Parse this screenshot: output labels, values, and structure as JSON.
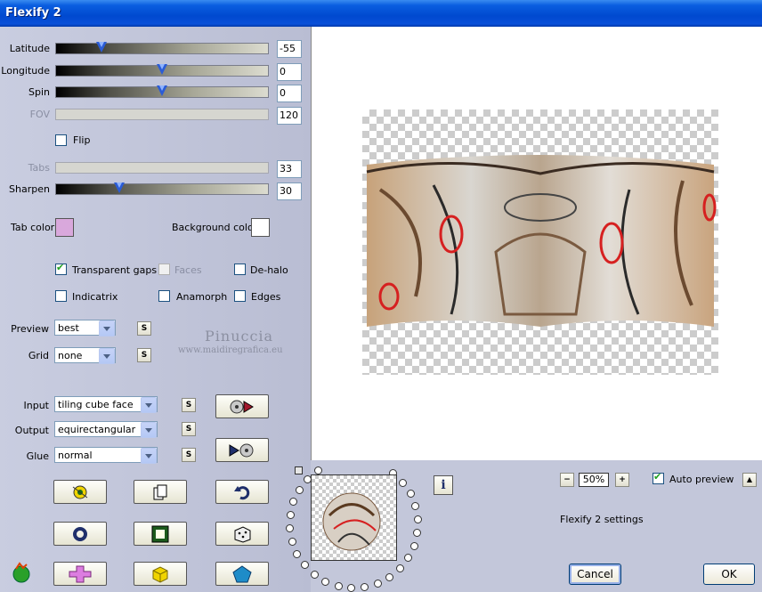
{
  "window": {
    "title": "Flexify 2"
  },
  "sliders": [
    {
      "label": "Latitude",
      "value": "-55",
      "fraction": 0.215,
      "enabled": true
    },
    {
      "label": "Longitude",
      "value": "0",
      "fraction": 0.5,
      "enabled": true
    },
    {
      "label": "Spin",
      "value": "0",
      "fraction": 0.5,
      "enabled": true
    },
    {
      "label": "FOV",
      "value": "120",
      "fraction": 0.0,
      "enabled": false
    },
    {
      "label": "Tabs",
      "value": "33",
      "fraction": 0.0,
      "enabled": false
    },
    {
      "label": "Sharpen",
      "value": "30",
      "fraction": 0.3,
      "enabled": true
    }
  ],
  "flip": {
    "label": "Flip",
    "checked": false
  },
  "colors": {
    "tab_label": "Tab color",
    "tab_value": "#d9a8dc",
    "background_label": "Background color",
    "background_value": "#ffffff"
  },
  "options": {
    "transparent_gaps": {
      "label": "Transparent gaps",
      "checked": true
    },
    "faces": {
      "label": "Faces",
      "checked": false,
      "enabled": false
    },
    "de_halo": {
      "label": "De-halo",
      "checked": false
    },
    "indicatrix": {
      "label": "Indicatrix",
      "checked": false
    },
    "anamorph": {
      "label": "Anamorph",
      "checked": false
    },
    "edges": {
      "label": "Edges",
      "checked": false
    }
  },
  "dropdowns": {
    "preview": {
      "label": "Preview",
      "value": "best"
    },
    "grid": {
      "label": "Grid",
      "value": "none"
    },
    "input": {
      "label": "Input",
      "value": "tiling cube face"
    },
    "output": {
      "label": "Output",
      "value": "equirectangular"
    },
    "glue": {
      "label": "Glue",
      "value": "normal"
    }
  },
  "small_button_label": "S",
  "watermark": {
    "line1": "Pinuccia",
    "line2": "www.maidiregrafica.eu"
  },
  "zoom": {
    "minus": "−",
    "value": "50%",
    "plus": "+"
  },
  "auto_preview": {
    "label": "Auto preview",
    "checked": true,
    "collapse": "▲"
  },
  "settings_label": "Flexify 2 settings",
  "buttons": {
    "cancel": "Cancel",
    "ok": "OK",
    "info": "i"
  },
  "accent_colors": {
    "titlebar": "#0054e3",
    "panel": "#c3c7da"
  }
}
